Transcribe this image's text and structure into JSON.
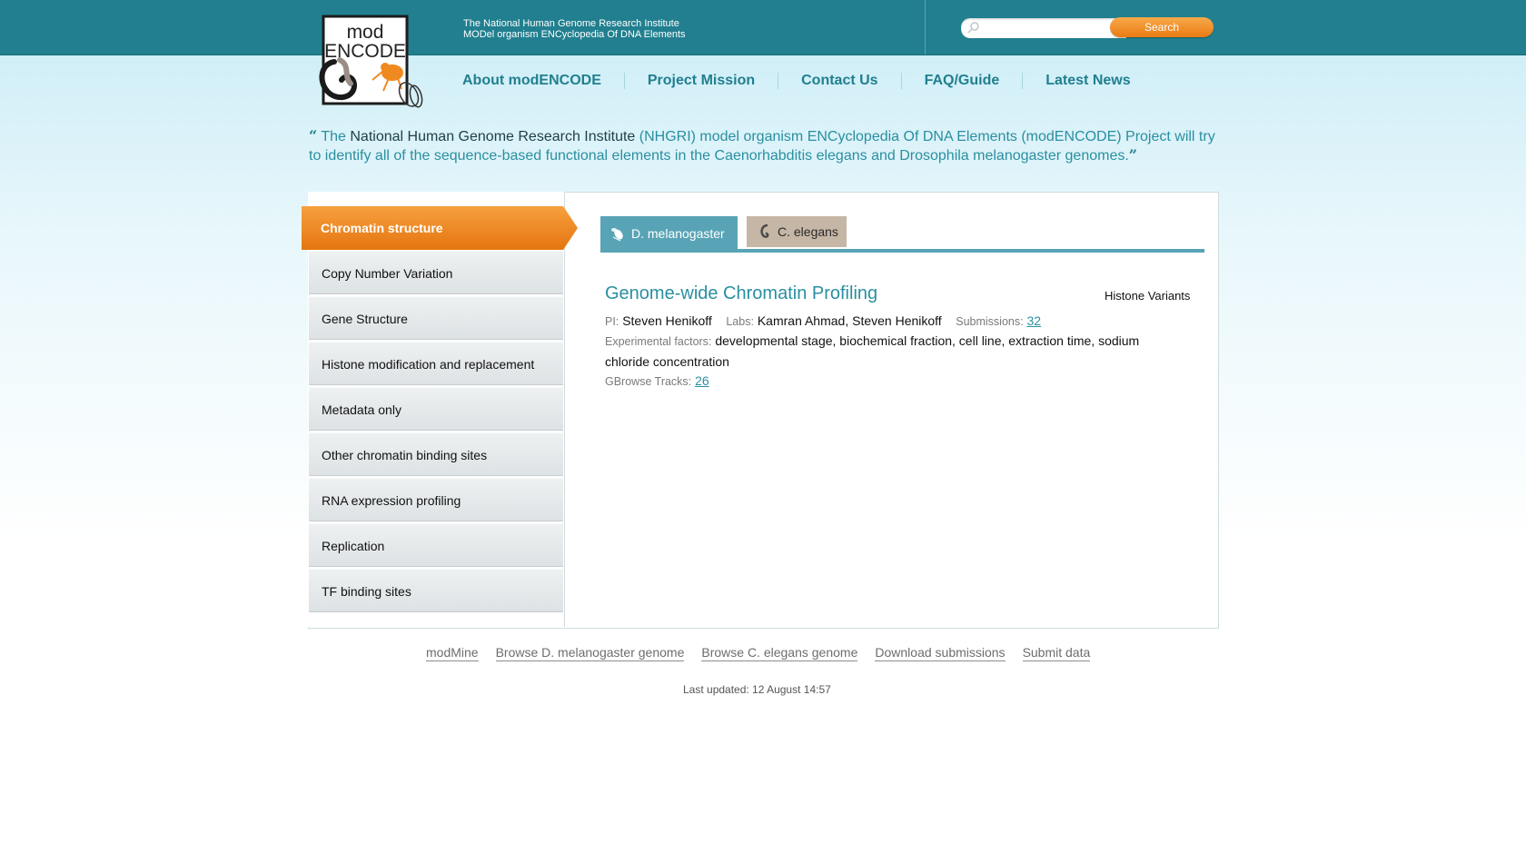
{
  "header": {
    "tagline_line1": "The National Human Genome Research Institute",
    "tagline_line2": "MODel organism ENCyclopedia Of DNA Elements",
    "logo_text_top": "mod",
    "logo_text_bottom": "ENCODE",
    "search": {
      "placeholder": "",
      "value": "",
      "button_label": "Search",
      "icon": "magnifier-icon"
    }
  },
  "nav": {
    "items": [
      "About modENCODE",
      "Project Mission",
      "Contact Us",
      "FAQ/Guide",
      "Latest News"
    ]
  },
  "quote": {
    "open": "“",
    "pre": "The ",
    "highlight": "National Human Genome Research Institute",
    "rest": " (NHGRI) model organism ENCyclopedia Of DNA Elements (modENCODE) Project will try to identify all of the sequence-based functional elements in the Caenorhabditis elegans and Drosophila melanogaster genomes.",
    "close": "”"
  },
  "sidebar": {
    "active": "Chromatin structure",
    "items": [
      "Copy Number Variation",
      "Gene Structure",
      "Histone modification and replacement",
      "Metadata only",
      "Other chromatin binding sites",
      "RNA expression profiling",
      "Replication",
      "TF binding sites"
    ]
  },
  "tabs": {
    "melanogaster": {
      "label": "D. melanogaster",
      "icon": "fly-icon"
    },
    "elegans": {
      "label": "C. elegans",
      "icon": "worm-icon"
    }
  },
  "project": {
    "title": "Genome-wide Chromatin Profiling",
    "category": "Histone Variants",
    "pi_label": "PI:",
    "pi": "Steven Henikoff",
    "labs_label": "Labs:",
    "labs": "Kamran Ahmad, Steven Henikoff",
    "submissions_label": "Submissions:",
    "submissions": "32",
    "factors_label": "Experimental factors:",
    "factors": "developmental stage, biochemical fraction, cell line, extraction time, sodium chloride concentration",
    "gbrowse_label": "GBrowse Tracks:",
    "gbrowse": "26"
  },
  "footer": {
    "links": [
      "modMine",
      "Browse D. melanogaster genome",
      "Browse C. elegans genome",
      "Download submissions",
      "Submit data"
    ],
    "updated": "Last updated: 12 August 14:57"
  },
  "colors": {
    "header_teal": "#217f8f",
    "accent_orange": "#ea7b13",
    "link_teal": "#2a8fa0",
    "tab_blue": "#58a4b6",
    "tab_tan": "#c5b6a5"
  }
}
